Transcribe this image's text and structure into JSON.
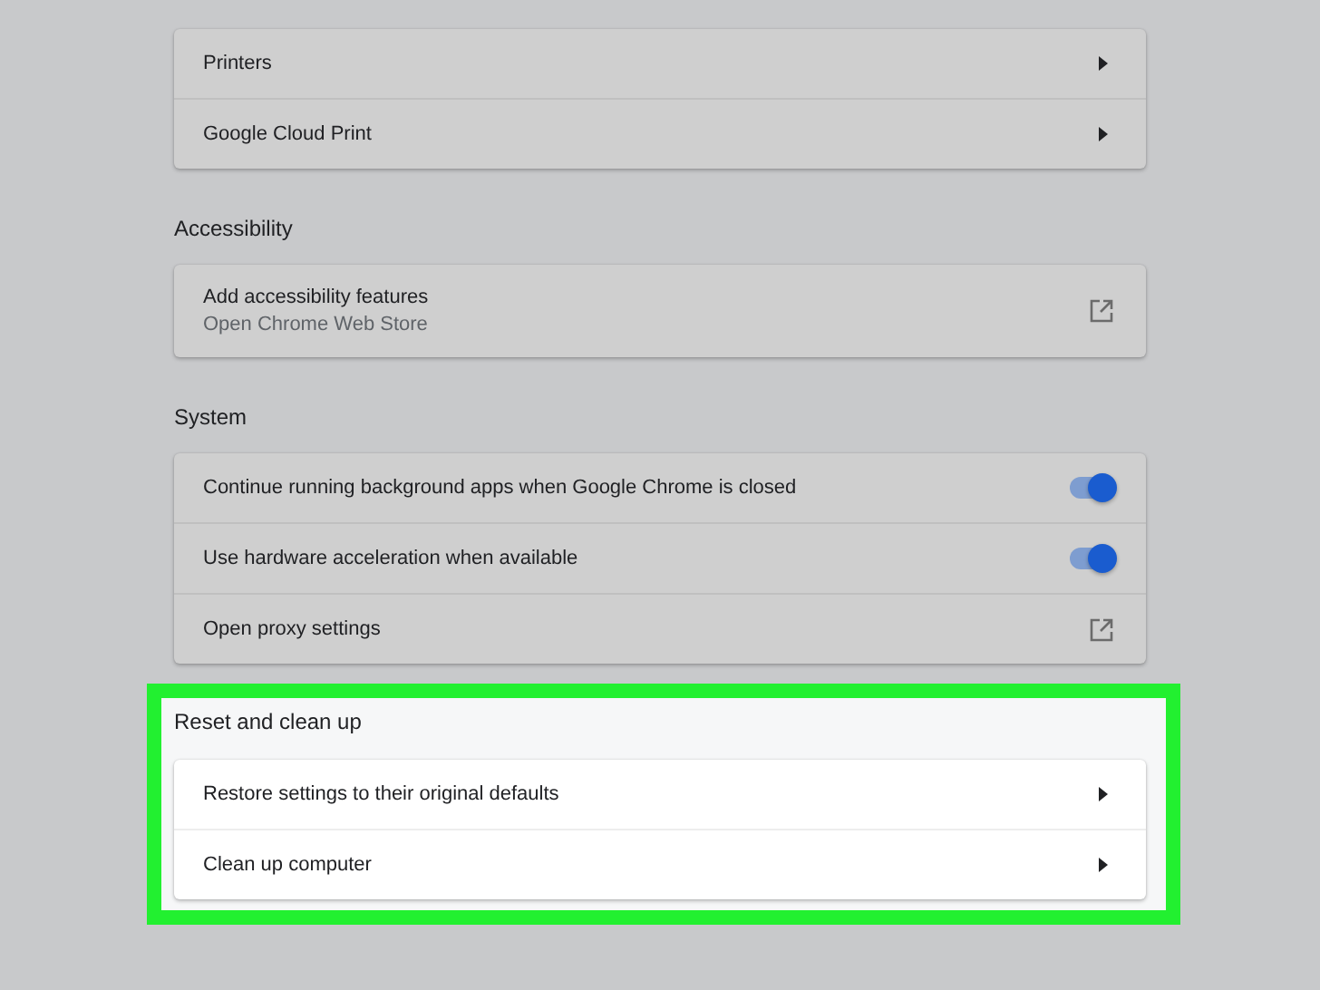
{
  "sections": [
    {
      "highlighted": false,
      "rows": [
        {
          "kind": "arrow",
          "label": "Printers"
        },
        {
          "kind": "arrow",
          "label": "Google Cloud Print"
        }
      ]
    },
    {
      "title": "Accessibility",
      "highlighted": false,
      "rows": [
        {
          "kind": "external",
          "label": "Add accessibility features",
          "sublabel": "Open Chrome Web Store"
        }
      ]
    },
    {
      "title": "System",
      "highlighted": false,
      "rows": [
        {
          "kind": "toggle",
          "label": "Continue running background apps when Google Chrome is closed",
          "on": true
        },
        {
          "kind": "toggle",
          "label": "Use hardware acceleration when available",
          "on": true
        },
        {
          "kind": "external",
          "label": "Open proxy settings"
        }
      ]
    },
    {
      "title": "Reset and clean up",
      "highlighted": true,
      "rows": [
        {
          "kind": "arrow",
          "label": "Restore settings to their original defaults"
        },
        {
          "kind": "arrow",
          "label": "Clean up computer"
        }
      ]
    }
  ]
}
